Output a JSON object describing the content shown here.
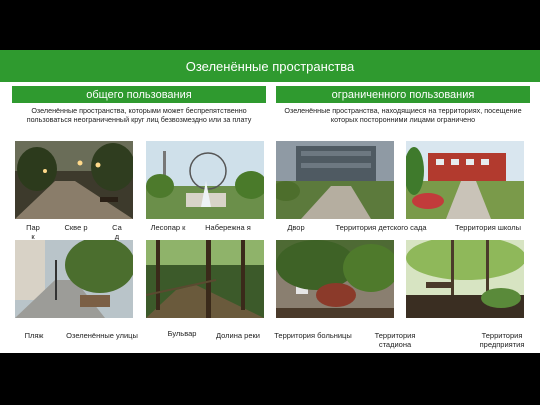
{
  "title": "Озеленённые пространства",
  "public": {
    "header": "общего пользования",
    "description": "Озеленённые пространства, которыми может беспрепятственно пользоваться неограниченный круг лиц безвозмездно или за плату",
    "labels_row1": [
      "Пар к",
      "Скве р",
      "Са д",
      "Лесопар к",
      "Набережна я"
    ],
    "labels_row2": [
      "Пляж",
      "Озеленённые улицы",
      "Бульвар",
      "Долина реки"
    ]
  },
  "restricted": {
    "header": "ограниченного пользования",
    "description": "Озеленённые пространства, находящиеся на территориях, посещение которых посторонними лицами ограничено",
    "labels_row1": [
      "Двор",
      "Территория детского сада",
      "Территория школы"
    ],
    "labels_row2": [
      "Территория больницы",
      "Территория стадиона",
      "Территория предприятия"
    ]
  },
  "colors": {
    "green_bar": "#2f9a2f",
    "band": "#000000"
  }
}
